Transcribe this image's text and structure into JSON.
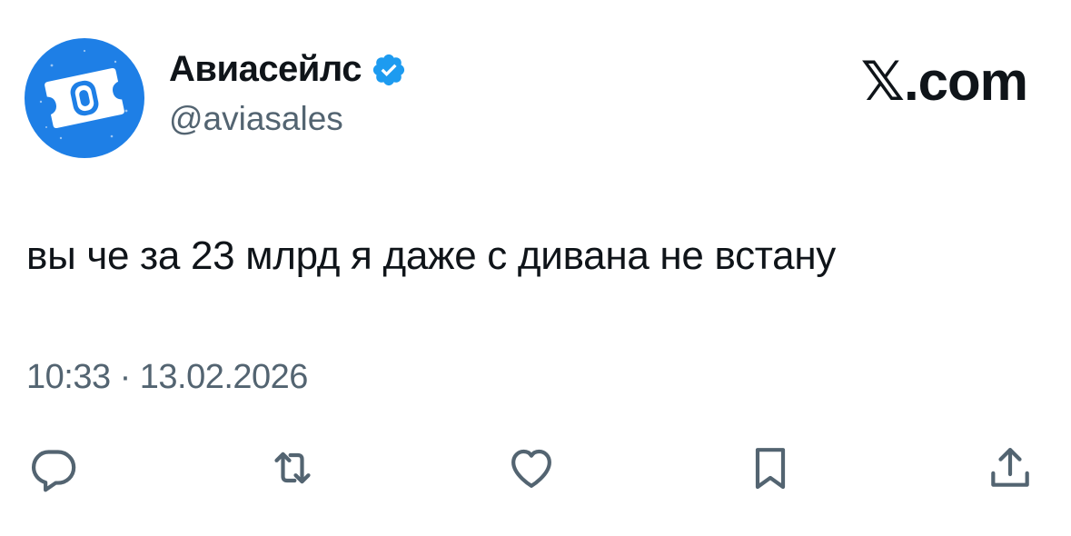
{
  "author": {
    "display_name": "Авиасейлс",
    "handle": "@aviasales",
    "verified": true,
    "avatar_icon": "aviasales-logo-icon",
    "avatar_color": "#1e7fe6"
  },
  "brand": {
    "x_glyph": "𝕏",
    "suffix": ".com"
  },
  "tweet": {
    "text": "вы че за 23 млрд я даже с дивана не встану",
    "time": "10:33",
    "separator": "·",
    "date": "13.02.2026"
  },
  "actions": [
    {
      "name": "reply",
      "icon": "reply-icon"
    },
    {
      "name": "retweet",
      "icon": "retweet-icon"
    },
    {
      "name": "like",
      "icon": "heart-icon"
    },
    {
      "name": "bookmark",
      "icon": "bookmark-icon"
    },
    {
      "name": "share",
      "icon": "share-icon"
    }
  ],
  "colors": {
    "text": "#0f1419",
    "secondary": "#536471",
    "verified": "#1d9bf0",
    "icons": "#536471"
  }
}
